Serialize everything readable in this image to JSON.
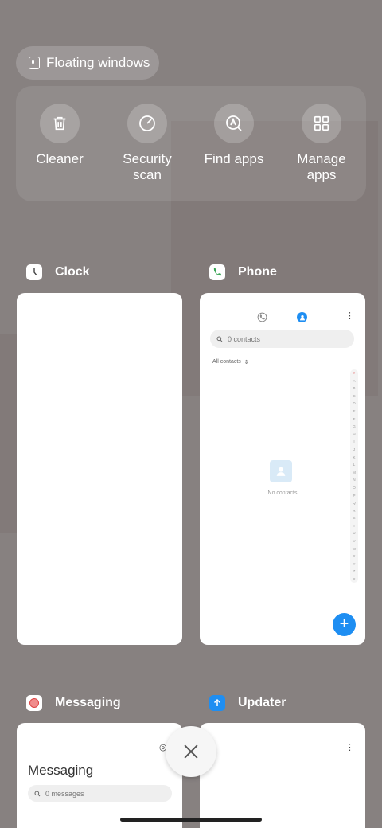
{
  "floating": {
    "label": "Floating windows"
  },
  "tools": [
    {
      "label": "Cleaner",
      "icon": "trash-icon"
    },
    {
      "label": "Security\nscan",
      "icon": "security-icon"
    },
    {
      "label": "Find apps",
      "icon": "find-apps-icon"
    },
    {
      "label": "Manage\napps",
      "icon": "grid-icon"
    }
  ],
  "apps": {
    "clock": {
      "name": "Clock"
    },
    "phone": {
      "name": "Phone",
      "search_placeholder": "0 contacts",
      "filter": "All contacts",
      "empty_text": "No contacts",
      "alphabet": [
        "♥",
        "A",
        "B",
        "C",
        "D",
        "E",
        "F",
        "G",
        "H",
        "I",
        "J",
        "K",
        "L",
        "M",
        "N",
        "O",
        "P",
        "Q",
        "R",
        "S",
        "T",
        "U",
        "V",
        "W",
        "X",
        "Y",
        "Z",
        "#"
      ]
    },
    "messaging": {
      "name": "Messaging",
      "title": "Messaging",
      "search_placeholder": "0 messages"
    },
    "updater": {
      "name": "Updater"
    }
  },
  "colors": {
    "background": "#878180",
    "accent": "#1e8ef2"
  }
}
